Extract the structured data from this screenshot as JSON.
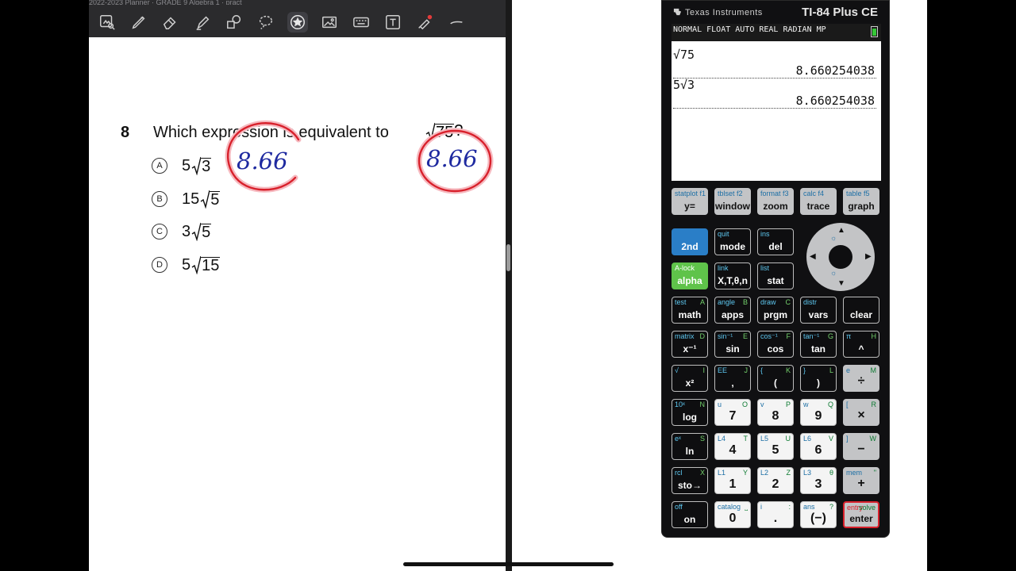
{
  "notes": {
    "toolbar_topstrip": "2022-2023 Planner          ·         GRADE 9 Algebra 1 · pract",
    "tools": [
      "lasso-ai",
      "pen",
      "eraser",
      "highlighter",
      "shapes",
      "lasso",
      "sticker",
      "image",
      "keyboard",
      "text",
      "laser",
      "more"
    ],
    "question": {
      "number": "8",
      "text": "Which expression is equivalent to",
      "radicand": "75",
      "end_mark": "?"
    },
    "choices": [
      {
        "letter": "A",
        "coef": "5",
        "radicand": "3"
      },
      {
        "letter": "B",
        "coef": "15",
        "radicand": "5"
      },
      {
        "letter": "C",
        "coef": "3",
        "radicand": "5"
      },
      {
        "letter": "D",
        "coef": "5",
        "radicand": "15"
      }
    ],
    "annotations": [
      "8.66",
      "8.66"
    ]
  },
  "calculator": {
    "brand": "Texas Instruments",
    "model": "TI-84 Plus CE",
    "status": "NORMAL FLOAT AUTO REAL RADIAN MP",
    "history": [
      {
        "entry": "√75",
        "result": "8.660254038"
      },
      {
        "entry": "5√3",
        "result": "8.660254038"
      }
    ],
    "keys": {
      "row1": [
        {
          "sec": "statplot f1",
          "lbl": "y="
        },
        {
          "sec": "tblset f2",
          "lbl": "window"
        },
        {
          "sec": "format f3",
          "lbl": "zoom"
        },
        {
          "sec": "calc f4",
          "lbl": "trace"
        },
        {
          "sec": "table f5",
          "lbl": "graph"
        }
      ],
      "row2": [
        {
          "sec": "",
          "lbl": "2nd"
        },
        {
          "sec": "quit",
          "lbl": "mode"
        },
        {
          "sec": "ins",
          "lbl": "del"
        }
      ],
      "row3": [
        {
          "sec": "A-lock",
          "lbl": "alpha"
        },
        {
          "sec": "link",
          "lbl": "X,T,θ,n"
        },
        {
          "sec": "list",
          "lbl": "stat"
        }
      ],
      "row4": [
        {
          "sec": "test",
          "alp": "A",
          "lbl": "math"
        },
        {
          "sec": "angle",
          "alp": "B",
          "lbl": "apps"
        },
        {
          "sec": "draw",
          "alp": "C",
          "lbl": "prgm"
        },
        {
          "sec": "distr",
          "alp": "",
          "lbl": "vars"
        },
        {
          "sec": "",
          "alp": "",
          "lbl": "clear"
        }
      ],
      "row5": [
        {
          "sec": "matrix",
          "alp": "D",
          "lbl": "x⁻¹"
        },
        {
          "sec": "sin⁻¹",
          "alp": "E",
          "lbl": "sin"
        },
        {
          "sec": "cos⁻¹",
          "alp": "F",
          "lbl": "cos"
        },
        {
          "sec": "tan⁻¹",
          "alp": "G",
          "lbl": "tan"
        },
        {
          "sec": "π",
          "alp": "H",
          "lbl": "^"
        }
      ],
      "row6": [
        {
          "sec": "√",
          "alp": "I",
          "lbl": "x²"
        },
        {
          "sec": "EE",
          "alp": "J",
          "lbl": ","
        },
        {
          "sec": "{",
          "alp": "K",
          "lbl": "("
        },
        {
          "sec": "}",
          "alp": "L",
          "lbl": ")"
        },
        {
          "sec": "e",
          "alp": "M",
          "lbl": "÷"
        }
      ],
      "row7": [
        {
          "sec": "10ˣ",
          "alp": "N",
          "lbl": "log"
        },
        {
          "sec": "u",
          "alp": "O",
          "lbl": "7"
        },
        {
          "sec": "v",
          "alp": "P",
          "lbl": "8"
        },
        {
          "sec": "w",
          "alp": "Q",
          "lbl": "9"
        },
        {
          "sec": "[",
          "alp": "R",
          "lbl": "×"
        }
      ],
      "row8": [
        {
          "sec": "eˣ",
          "alp": "S",
          "lbl": "ln"
        },
        {
          "sec": "L4",
          "alp": "T",
          "lbl": "4"
        },
        {
          "sec": "L5",
          "alp": "U",
          "lbl": "5"
        },
        {
          "sec": "L6",
          "alp": "V",
          "lbl": "6"
        },
        {
          "sec": "]",
          "alp": "W",
          "lbl": "−"
        }
      ],
      "row9": [
        {
          "sec": "rcl",
          "alp": "X",
          "lbl": "sto→"
        },
        {
          "sec": "L1",
          "alp": "Y",
          "lbl": "1"
        },
        {
          "sec": "L2",
          "alp": "Z",
          "lbl": "2"
        },
        {
          "sec": "L3",
          "alp": "θ",
          "lbl": "3"
        },
        {
          "sec": "mem",
          "alp": "\"",
          "lbl": "+"
        }
      ],
      "row10": [
        {
          "sec": "off",
          "alp": "",
          "lbl": "on"
        },
        {
          "sec": "catalog",
          "alp": "⎵",
          "lbl": "0"
        },
        {
          "sec": "i",
          "alp": ":",
          "lbl": "."
        },
        {
          "sec": "ans",
          "alp": "?",
          "lbl": "(−)"
        },
        {
          "sec": "entry",
          "alp": "solve",
          "lbl": "enter"
        }
      ]
    }
  }
}
